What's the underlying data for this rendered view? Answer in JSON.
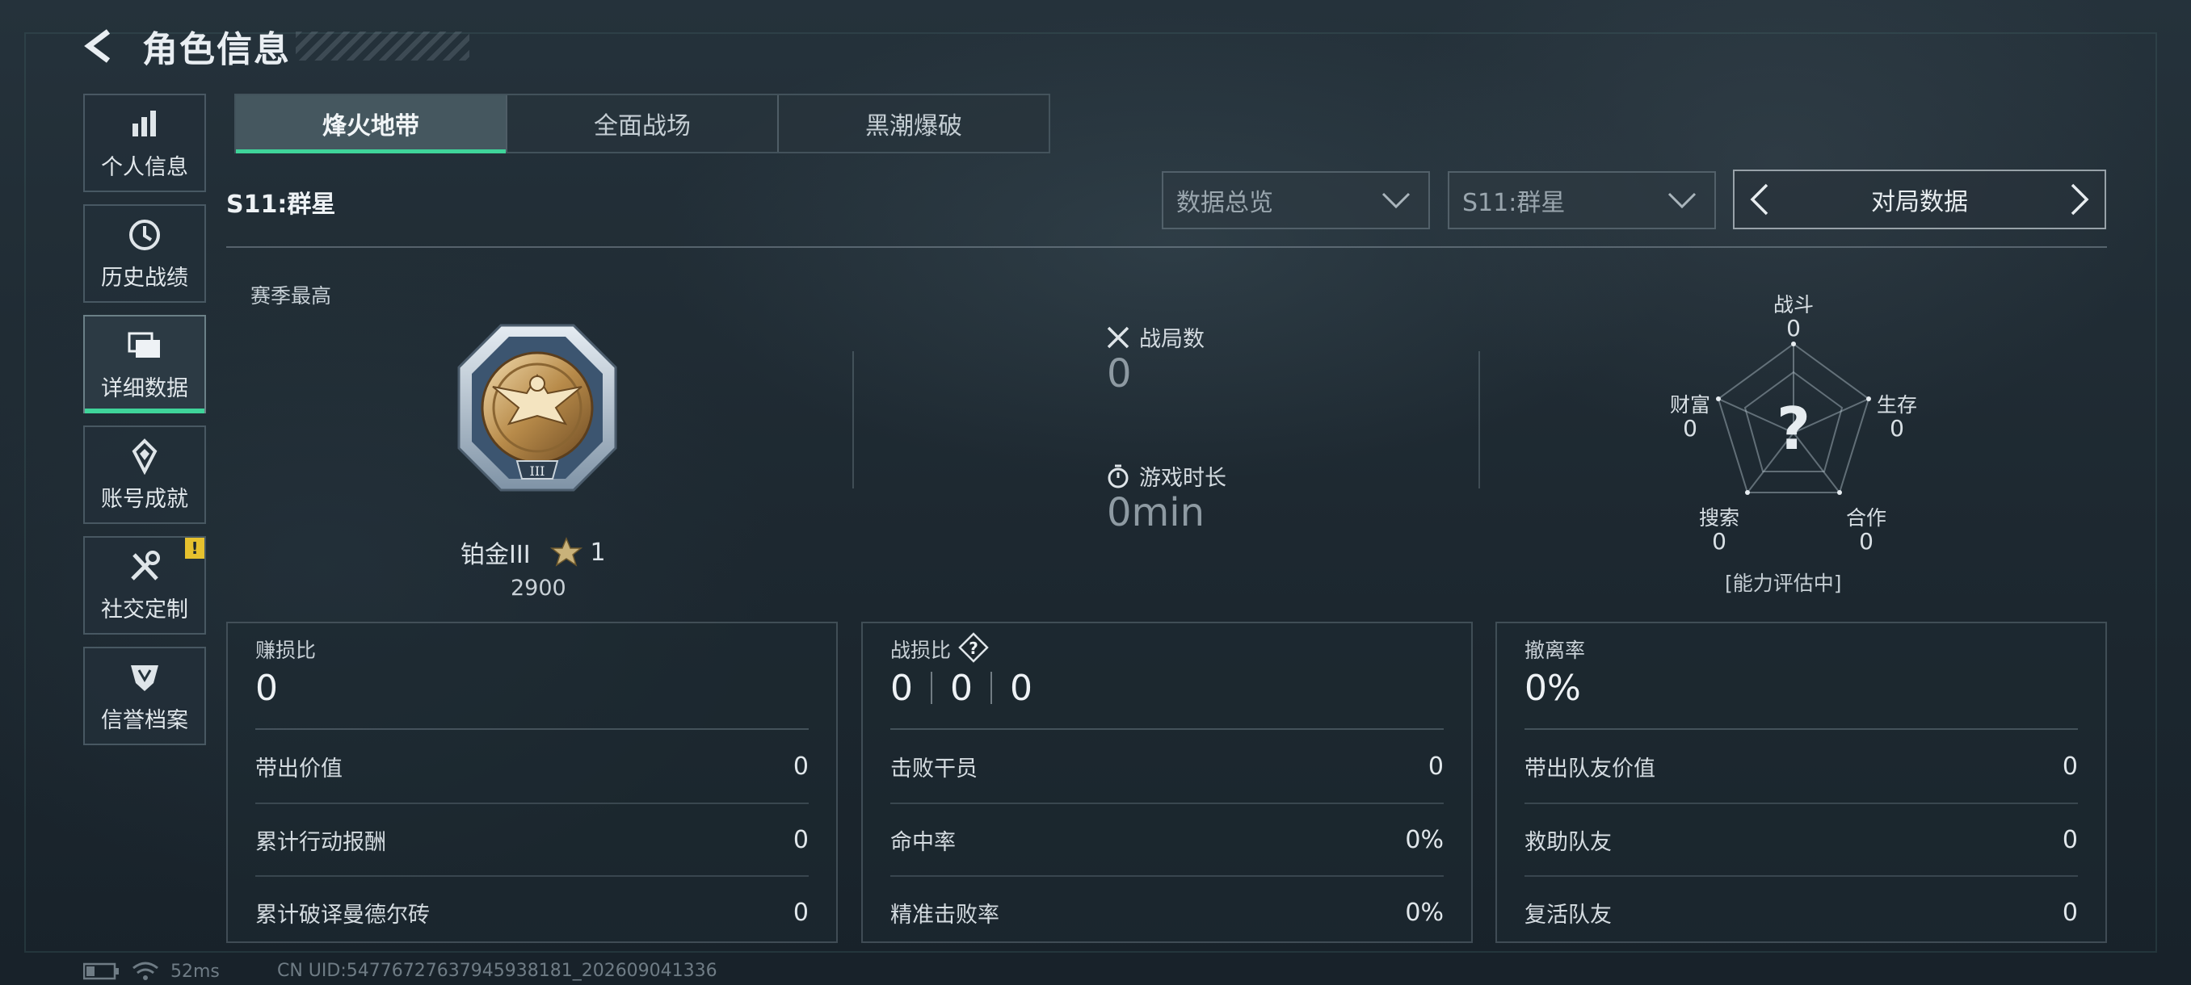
{
  "header": {
    "title": "角色信息"
  },
  "sidebar": {
    "items": [
      {
        "label": "个人信息",
        "icon": "bar-chart-icon"
      },
      {
        "label": "历史战绩",
        "icon": "clock-icon"
      },
      {
        "label": "详细数据",
        "icon": "folder-icon",
        "active": true
      },
      {
        "label": "账号成就",
        "icon": "achievement-icon"
      },
      {
        "label": "社交定制",
        "icon": "tools-icon",
        "badge": "!"
      },
      {
        "label": "信誉档案",
        "icon": "shield-icon"
      }
    ]
  },
  "tabs": [
    {
      "label": "烽火地带",
      "active": true
    },
    {
      "label": "全面战场"
    },
    {
      "label": "黑潮爆破"
    }
  ],
  "season": {
    "title": "S11:群星"
  },
  "filters": {
    "data_type": "数据总览",
    "season": "S11:群星",
    "pager_label": "对局数据"
  },
  "overview": {
    "season_best_label": "赛季最高",
    "rank_name": "铂金III",
    "rank_stars": "1",
    "rank_score": "2900",
    "matches_label": "战局数",
    "matches_value": "0",
    "playtime_label": "游戏时长",
    "playtime_value": "0min"
  },
  "radar": {
    "labels": {
      "combat": "战斗",
      "survival": "生存",
      "cooperation": "合作",
      "search": "搜索",
      "wealth": "财富"
    },
    "values": {
      "combat": "0",
      "survival": "0",
      "cooperation": "0",
      "search": "0",
      "wealth": "0"
    },
    "center_mark": "?",
    "status": "[能力评估中]"
  },
  "cards": {
    "profit": {
      "title": "赚损比",
      "value": "0",
      "rows": [
        {
          "label": "带出价值",
          "value": "0"
        },
        {
          "label": "累计行动报酬",
          "value": "0"
        },
        {
          "label": "累计破译曼德尔砖",
          "value": "0"
        }
      ]
    },
    "kd": {
      "title": "战损比",
      "values": [
        "0",
        "0",
        "0"
      ],
      "rows": [
        {
          "label": "击败干员",
          "value": "0"
        },
        {
          "label": "命中率",
          "value": "0%"
        },
        {
          "label": "精准击败率",
          "value": "0%"
        }
      ]
    },
    "extract": {
      "title": "撤离率",
      "value": "0%",
      "rows": [
        {
          "label": "带出队友价值",
          "value": "0"
        },
        {
          "label": "救助队友",
          "value": "0"
        },
        {
          "label": "复活队友",
          "value": "0"
        }
      ]
    }
  },
  "status_bar": {
    "ping": "52ms",
    "uid": "CN UID:54776727637945938181_202609041336"
  },
  "colors": {
    "accent": "#3fd49a",
    "badge": "#e6c12e",
    "background": "#1e2a32"
  }
}
